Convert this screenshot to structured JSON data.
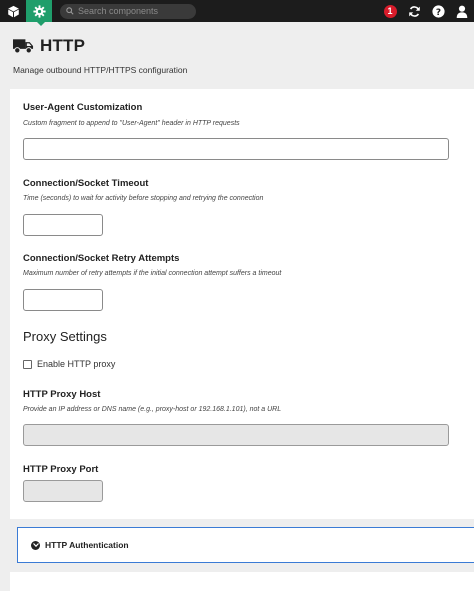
{
  "topbar": {
    "search_placeholder": "Search components",
    "alert_count": "1"
  },
  "header": {
    "title": "HTTP",
    "description": "Manage outbound HTTP/HTTPS configuration"
  },
  "form": {
    "user_agent": {
      "label": "User-Agent Customization",
      "help": "Custom fragment to append to \"User-Agent\" header in HTTP requests",
      "value": ""
    },
    "timeout": {
      "label": "Connection/Socket Timeout",
      "help": "Time (seconds) to wait for activity before stopping and retrying the connection",
      "value": ""
    },
    "retry": {
      "label": "Connection/Socket Retry Attempts",
      "help": "Maximum number of retry attempts if the initial connection attempt suffers a timeout",
      "value": ""
    },
    "proxy_section_title": "Proxy Settings",
    "enable_proxy_label": "Enable HTTP proxy",
    "proxy_host": {
      "label": "HTTP Proxy Host",
      "help": "Provide an IP address or DNS name (e.g., proxy-host or 192.168.1.101), not a URL",
      "value": ""
    },
    "proxy_port": {
      "label": "HTTP Proxy Port",
      "value": ""
    }
  },
  "collapsible": {
    "auth_label": "HTTP Authentication"
  },
  "colors": {
    "topbar_bg": "#1c1c1c",
    "active_accent": "#1f9e6b",
    "alert": "#d81c2b",
    "focus_border": "#3a7bd5"
  }
}
